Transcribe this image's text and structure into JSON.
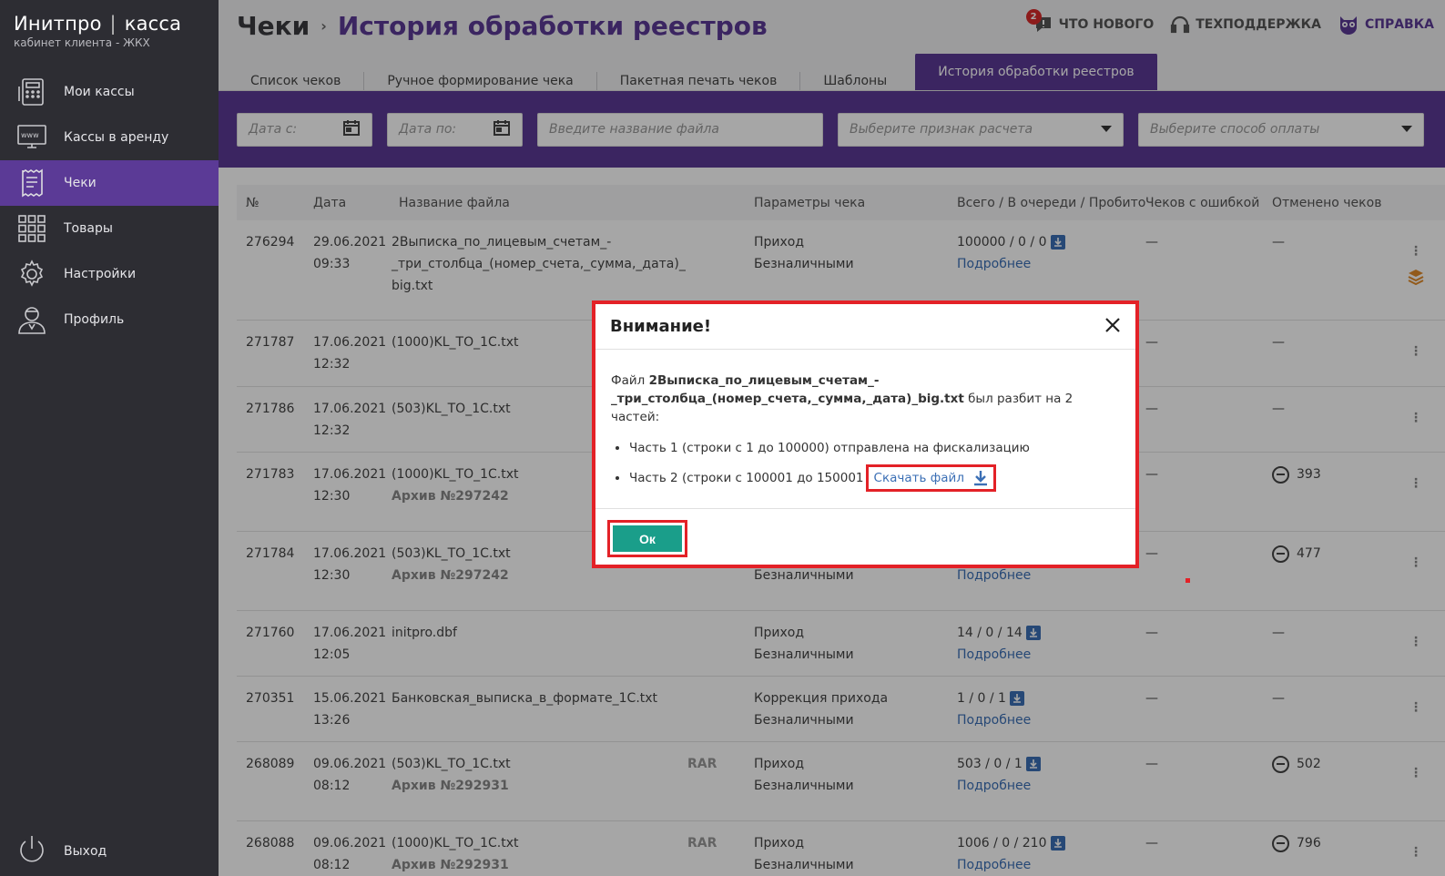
{
  "app": {
    "brand": "Инитпро",
    "brand_sep": "|",
    "brand_suffix": "касса",
    "subtitle": "кабинет клиента - ЖКХ"
  },
  "sidebar": {
    "items": [
      {
        "label": "Мои кассы",
        "icon": "cash-register-icon"
      },
      {
        "label": "Кассы в аренду",
        "icon": "www-terminal-icon"
      },
      {
        "label": "Чеки",
        "icon": "receipt-icon"
      },
      {
        "label": "Товары",
        "icon": "grid-icon"
      },
      {
        "label": "Настройки",
        "icon": "gear-icon"
      },
      {
        "label": "Профиль",
        "icon": "user-icon"
      }
    ],
    "logout": "Выход"
  },
  "header": {
    "crumb1": "Чеки",
    "crumb_arrow": "›",
    "crumb2": "История обработки реестров",
    "whatsnew": "ЧТО НОВОГО",
    "whatsnew_badge": "2",
    "support": "ТЕХПОДДЕРЖКА",
    "help": "СПРАВКА"
  },
  "tabs": [
    "Список чеков",
    "Ручное формирование чека",
    "Пакетная печать чеков",
    "Шаблоны",
    "История обработки реестров"
  ],
  "filters": {
    "date_from": "Дата с:",
    "date_to": "Дата по:",
    "file": "Введите название файла",
    "sign": "Выберите признак расчета",
    "payment": "Выберите способ оплаты"
  },
  "table": {
    "headers": [
      "№",
      "Дата",
      "Название файла",
      "Параметры чека",
      "Всего / В очереди / Пробито",
      "Чеков с ошибкой",
      "Отменено чеков"
    ],
    "rows": [
      {
        "num": "276294",
        "date": "29.06.2021",
        "time": "09:33",
        "file": "2Выписка_по_лицевым_счетам_-",
        "file2": "_три_столбца_(номер_счета,_сумма,_дата)_",
        "file3": "big.txt",
        "archive": "",
        "rar": "",
        "p1": "Приход",
        "p2": "Безналичными",
        "total": "100000 / 0 / 0",
        "more": "Подробнее",
        "err": "—",
        "canceled": "—"
      },
      {
        "num": "271787",
        "date": "17.06.2021",
        "time": "12:32",
        "file": "(1000)KL_TO_1C.txt",
        "file2": "",
        "file3": "",
        "archive": "",
        "rar": "",
        "p1": "",
        "p2": "",
        "total": "",
        "more": "",
        "err": "—",
        "canceled": "—"
      },
      {
        "num": "271786",
        "date": "17.06.2021",
        "time": "12:32",
        "file": "(503)KL_TO_1C.txt",
        "file2": "",
        "file3": "",
        "archive": "",
        "rar": "",
        "p1": "",
        "p2": "",
        "total": "",
        "more": "",
        "err": "—",
        "canceled": "—"
      },
      {
        "num": "271783",
        "date": "17.06.2021",
        "time": "12:30",
        "file": "(1000)KL_TO_1C.txt",
        "file2": "",
        "file3": "",
        "archive": "Архив №297242",
        "rar": "",
        "p1": "",
        "p2": "",
        "total": "",
        "more": "",
        "err": "—",
        "canceled": "393"
      },
      {
        "num": "271784",
        "date": "17.06.2021",
        "time": "12:30",
        "file": "(503)KL_TO_1C.txt",
        "file2": "",
        "file3": "",
        "archive": "Архив №297242",
        "rar": "",
        "p1": "",
        "p2": "Безналичными",
        "total": "",
        "more": "Подробнее",
        "err": "—",
        "canceled": "477"
      },
      {
        "num": "271760",
        "date": "17.06.2021",
        "time": "12:05",
        "file": "initpro.dbf",
        "file2": "",
        "file3": "",
        "archive": "",
        "rar": "",
        "p1": "Приход",
        "p2": "Безналичными",
        "total": "14 / 0 / 14",
        "more": "Подробнее",
        "err": "—",
        "canceled": "—"
      },
      {
        "num": "270351",
        "date": "15.06.2021",
        "time": "13:26",
        "file": "Банковская_выписка_в_формате_1C.txt",
        "file2": "",
        "file3": "",
        "archive": "",
        "rar": "",
        "p1": "Коррекция прихода",
        "p2": "Безналичными",
        "total": "1 / 0 / 1",
        "more": "Подробнее",
        "err": "—",
        "canceled": "—"
      },
      {
        "num": "268089",
        "date": "09.06.2021",
        "time": "08:12",
        "file": "(503)KL_TO_1C.txt",
        "file2": "",
        "file3": "",
        "archive": "Архив №292931",
        "rar": "RAR",
        "p1": "Приход",
        "p2": "Безналичными",
        "total": "503 / 0 / 1",
        "more": "Подробнее",
        "err": "—",
        "canceled": "502"
      },
      {
        "num": "268088",
        "date": "09.06.2021",
        "time": "08:12",
        "file": "(1000)KL_TO_1C.txt",
        "file2": "",
        "file3": "",
        "archive": "Архив №292931",
        "rar": "RAR",
        "p1": "Приход",
        "p2": "Безналичными",
        "total": "1006 / 0 / 210",
        "more": "Подробнее",
        "err": "—",
        "canceled": "796"
      }
    ]
  },
  "modal": {
    "title": "Внимание!",
    "intro_pre": "Файл",
    "intro_file": "2Выписка_по_лицевым_счетам_-_три_столбца_(номер_счета,_сумма,_дата)_big.txt",
    "intro_post": "был разбит на 2 частей:",
    "part1": "Часть 1 (строки с 1 до 100000) отправлена на фискализацию",
    "part2": "Часть 2 (строки с 100001 до 150001",
    "download": "Скачать файл",
    "ok": "Ок"
  },
  "colors": {
    "accent": "#5b3a96",
    "sidebar": "#2d2d33",
    "ok": "#1a9e8a",
    "highlight": "#e32127",
    "link": "#3b6fb5"
  }
}
